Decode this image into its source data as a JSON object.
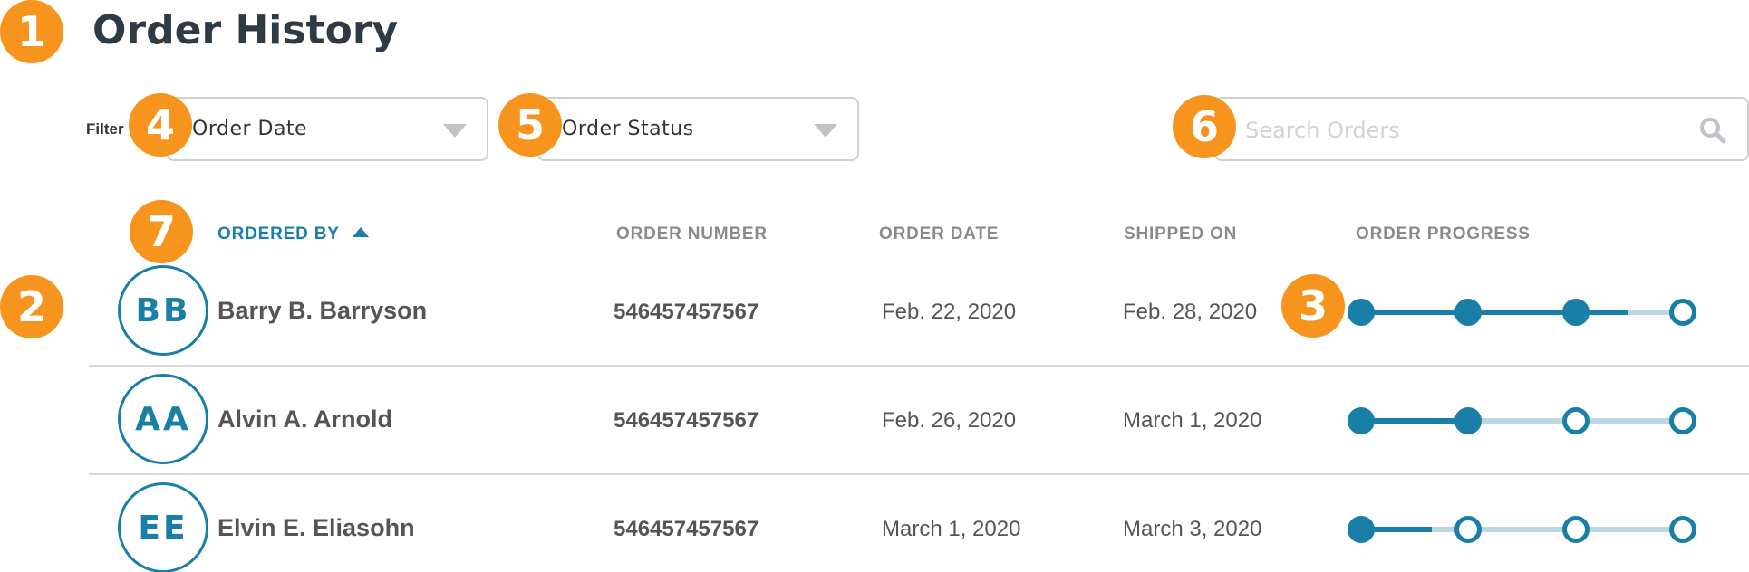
{
  "page": {
    "title": "Order History"
  },
  "callouts": [
    "1",
    "2",
    "3",
    "4",
    "5",
    "6",
    "7"
  ],
  "filter": {
    "label": "Filter",
    "order_date": {
      "selected": "Order Date"
    },
    "order_status": {
      "selected": "Order Status"
    }
  },
  "search": {
    "placeholder": "Search Orders",
    "value": ""
  },
  "table": {
    "headers": {
      "ordered_by": "ORDERED BY",
      "order_number": "ORDER NUMBER",
      "order_date": "ORDER DATE",
      "shipped_on": "SHIPPED ON",
      "order_progress": "ORDER PROGRESS"
    },
    "sort": {
      "column": "ordered_by",
      "direction": "ascending"
    },
    "rows": [
      {
        "initials": "BB",
        "name": "Barry B. Barryson",
        "order_number": "546457457567",
        "order_date": "Feb. 22, 2020",
        "shipped_on": "Feb. 28, 2020",
        "progress": {
          "steps_total": 4,
          "steps_completed": 3,
          "fill_fraction": 0.83
        }
      },
      {
        "initials": "AA",
        "name": "Alvin A. Arnold",
        "order_number": "546457457567",
        "order_date": "Feb. 26, 2020",
        "shipped_on": "March 1, 2020",
        "progress": {
          "steps_total": 4,
          "steps_completed": 2,
          "fill_fraction": 0.33
        }
      },
      {
        "initials": "EE",
        "name": "Elvin E. Eliasohn",
        "order_number": "546457457567",
        "order_date": "March 1, 2020",
        "shipped_on": "March 3, 2020",
        "progress": {
          "steps_total": 4,
          "steps_completed": 1,
          "fill_fraction": 0.22
        }
      }
    ]
  },
  "colors": {
    "accent": "#1a7fa6",
    "callout": "#f7941d",
    "track": "#bcd6e3",
    "title": "#2e3a45"
  },
  "icons": {
    "search": "search-icon",
    "dropdown": "chevron-down-icon",
    "sort": "sort-ascending-icon"
  }
}
